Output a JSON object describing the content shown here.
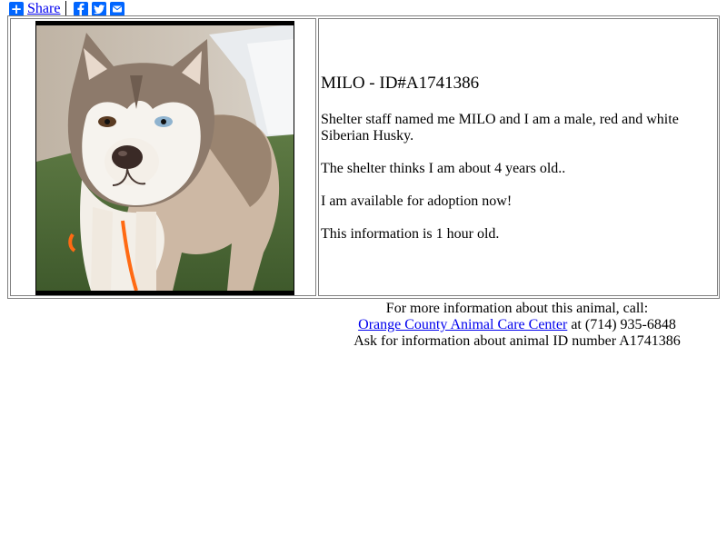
{
  "share": {
    "label": "Share",
    "icons": [
      "plus-icon",
      "facebook-icon",
      "twitter-icon",
      "email-icon"
    ],
    "brand_color": "#0166ff"
  },
  "pet": {
    "photo_alt": "Photo of Siberian Husky MILO",
    "title": "MILO - ID#A1741386",
    "paragraphs": [
      "Shelter staff named me MILO and I am a male, red and white Siberian Husky.",
      "The shelter thinks I am about 4 years old..",
      "I am available for adoption now!",
      "This information is 1 hour old."
    ]
  },
  "footer": {
    "line1": "For more information about this animal, call:",
    "shelter_link": "Orange County Animal Care Center",
    "phone_text": " at (714) 935-6848",
    "line3": "Ask for information about animal ID number A1741386"
  },
  "colors": {
    "link": "#0000ee",
    "border": "#808080"
  }
}
